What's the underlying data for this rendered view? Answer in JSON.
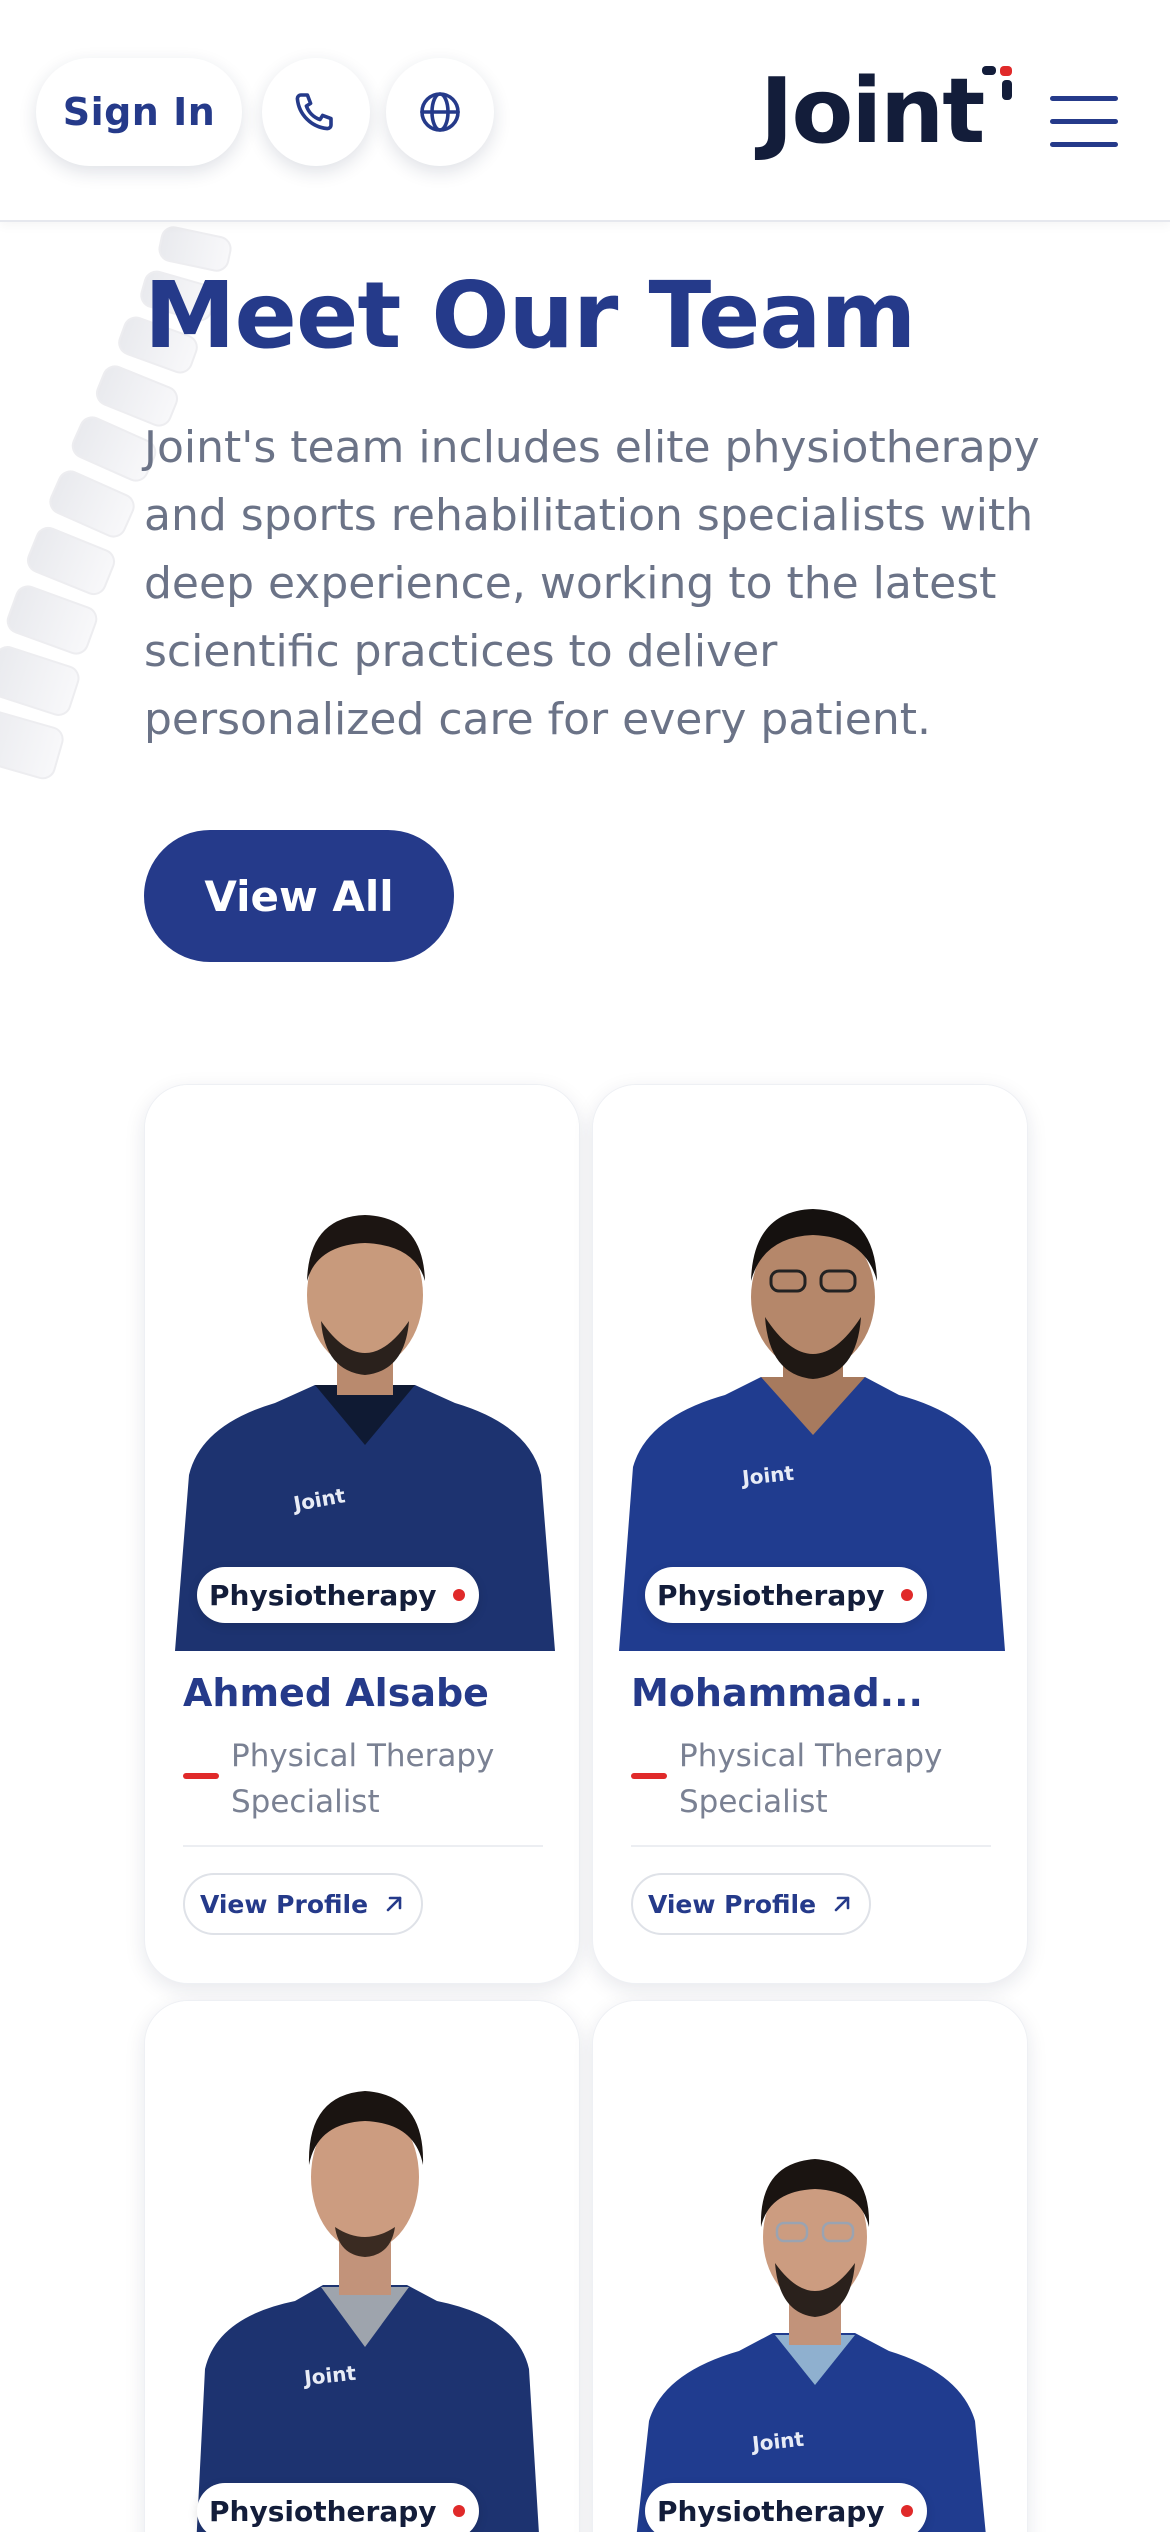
{
  "header": {
    "sign_in_label": "Sign In",
    "logo_text": "Joint",
    "icons": [
      "phone-icon",
      "globe-icon",
      "hamburger-menu-icon"
    ]
  },
  "hero": {
    "title": "Meet Our Team",
    "description": "Joint's team includes elite physiotherapy and sports rehabilitation specialists with deep experience, working to the latest scientific practices to deliver personalized care for every patient.",
    "view_all_label": "View All"
  },
  "team": [
    {
      "tag": "Physiotherapy",
      "name": "Ahmed Alsabe",
      "role": "Physical Therapy Specialist",
      "profile_label": "View Profile"
    },
    {
      "tag": "Physiotherapy",
      "name": "Mohammad...",
      "role": "Physical Therapy Specialist",
      "profile_label": "View Profile"
    },
    {
      "tag": "Physiotherapy"
    },
    {
      "tag": "Physiotherapy"
    }
  ],
  "colors": {
    "brand_blue": "#253a8a",
    "logo_dark": "#131d3a",
    "accent_red": "#e02a2a",
    "scrub_navy": "#1d3370",
    "text_gray": "#6b7387"
  }
}
